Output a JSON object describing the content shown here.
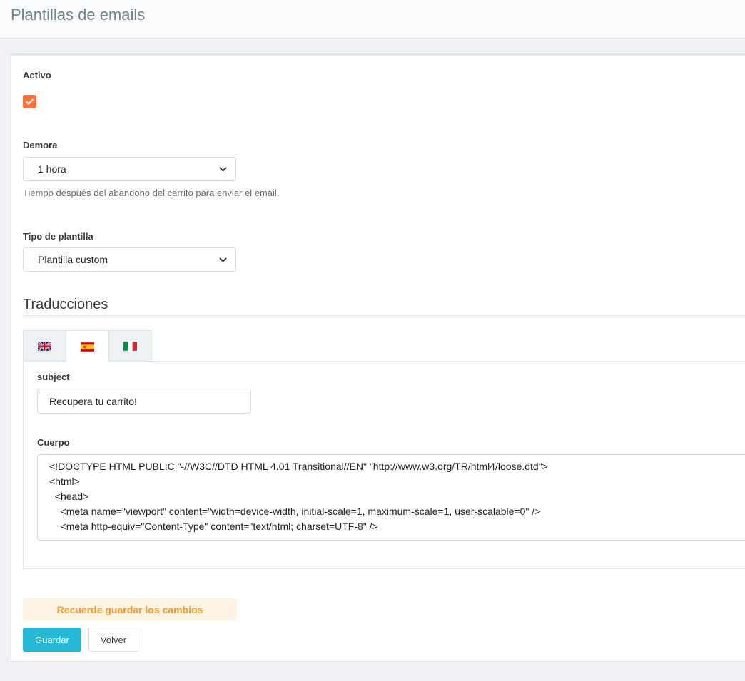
{
  "header": {
    "title": "Plantillas de emails"
  },
  "form": {
    "active": {
      "label": "Activo",
      "checked": true
    },
    "delay": {
      "label": "Demora",
      "selected": "1 hora",
      "help": "Tiempo después del abandono del carrito para enviar el email."
    },
    "template_type": {
      "label": "Tipo de plantilla",
      "selected": "Plantilla custom"
    }
  },
  "translations": {
    "title": "Traducciones",
    "tabs": [
      {
        "lang": "en",
        "icon": "uk-flag-icon",
        "active": false
      },
      {
        "lang": "es",
        "icon": "spain-flag-icon",
        "active": true
      },
      {
        "lang": "it",
        "icon": "italy-flag-icon",
        "active": false
      }
    ],
    "subject_label": "subject",
    "subject_value": "Recupera tu carrito!",
    "body_label": "Cuerpo",
    "body_lines": [
      "<!DOCTYPE HTML PUBLIC \"-//W3C//DTD HTML 4.01 Transitional//EN\" \"http://www.w3.org/TR/html4/loose.dtd\">",
      "<html>",
      "  <head>",
      "    <meta name=\"viewport\" content=\"width=device-width, initial-scale=1, maximum-scale=1, user-scalable=0\" />",
      "    <meta http-equiv=\"Content-Type\" content=\"text/html; charset=UTF-8\" />"
    ]
  },
  "footer": {
    "notice": "Recuerde guardar los cambios",
    "save_label": "Guardar",
    "back_label": "Volver"
  },
  "colors": {
    "accent_orange": "#fe6f3a",
    "primary_blue": "#25b9d7",
    "notice_bg": "#fff3e4",
    "notice_text": "#f49a2a"
  }
}
